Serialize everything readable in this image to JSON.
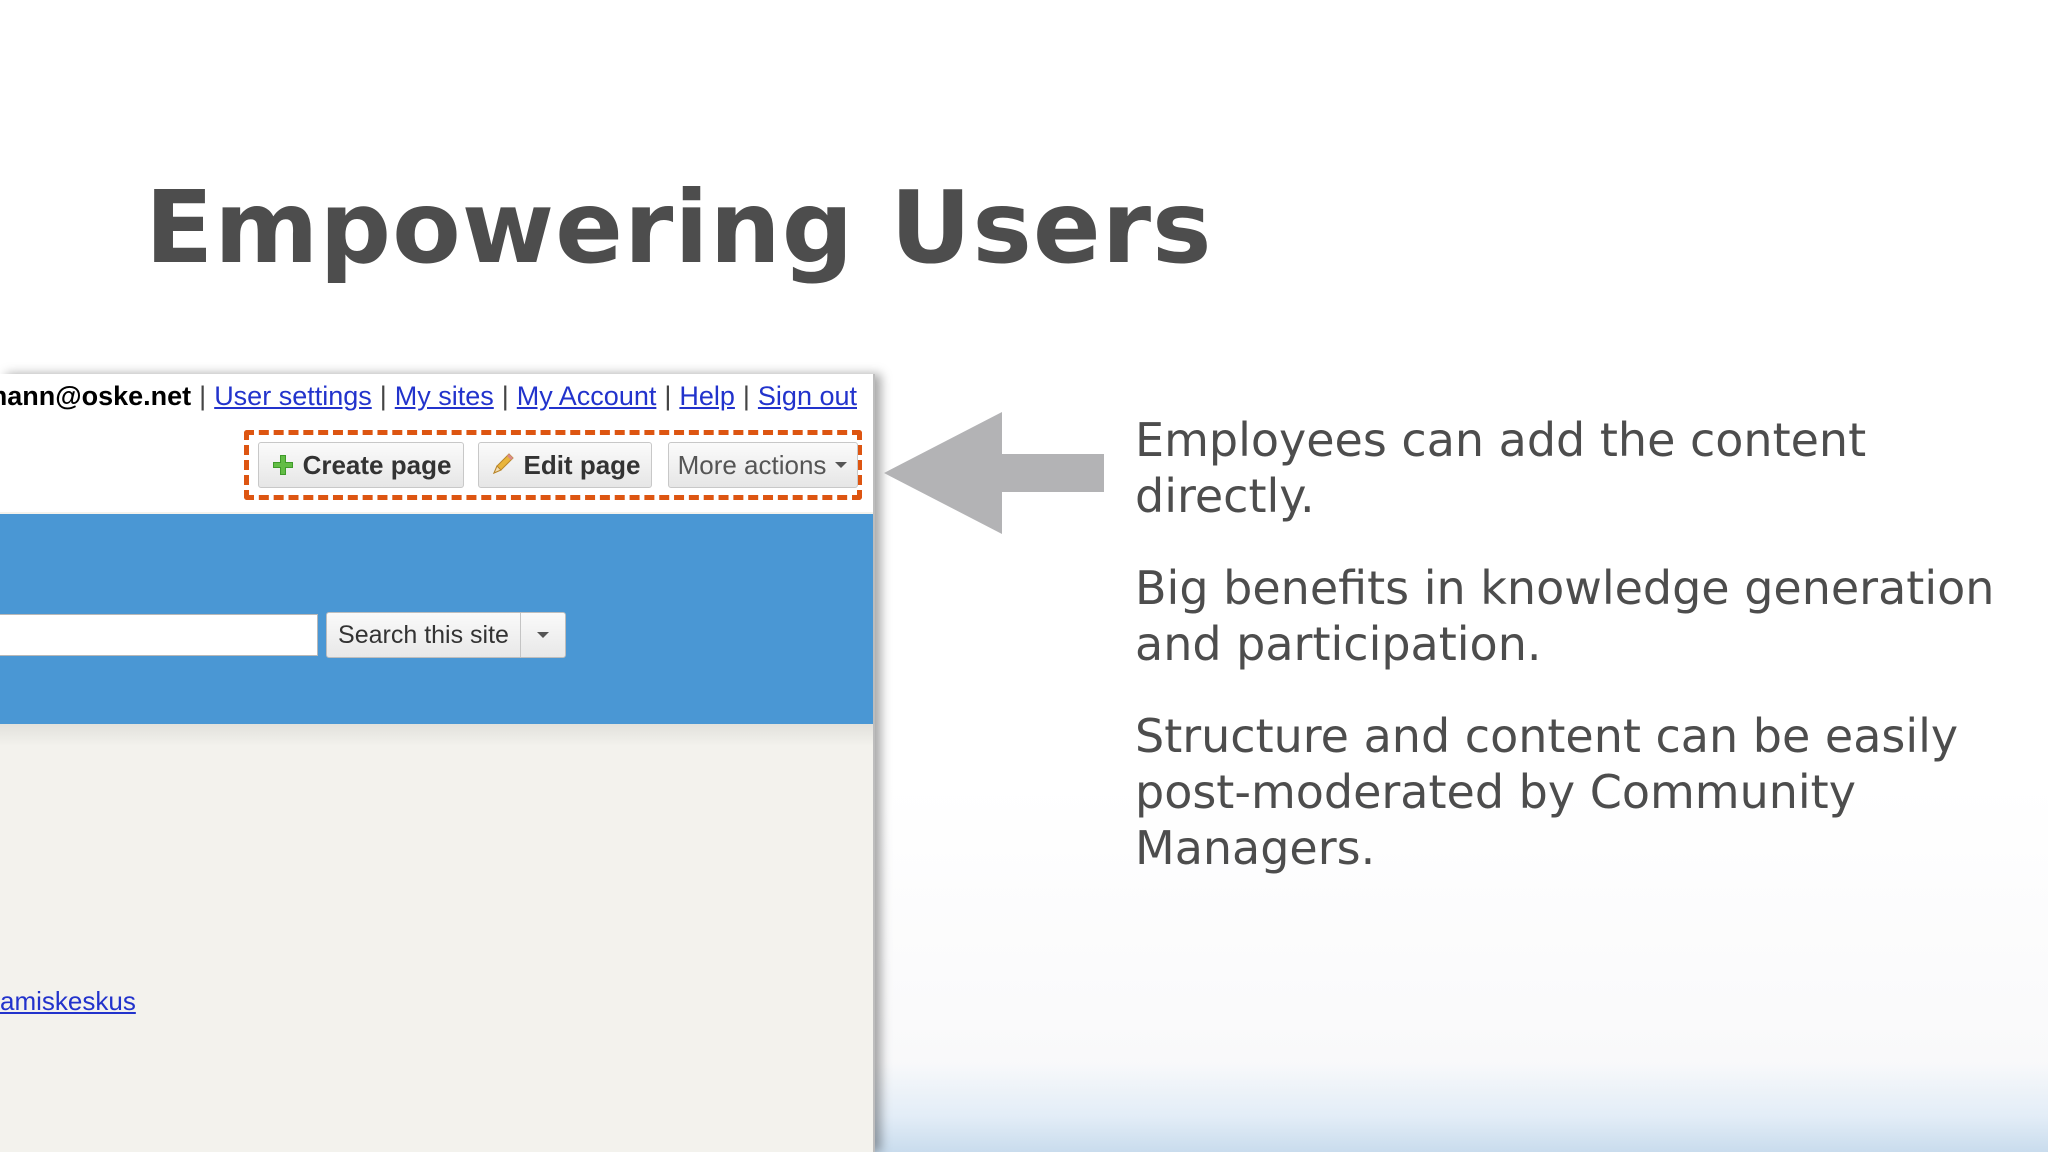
{
  "slide": {
    "title": "Empowering Users",
    "bullets": [
      "Employees can add the content directly.",
      "Big benefits in knowledge generation and participation.",
      "Structure and content can be easily post-moderated by Community Managers."
    ]
  },
  "screenshot": {
    "user_email": "mann@oske.net",
    "separator": "|",
    "links": {
      "user_settings": "User settings",
      "my_sites": "My sites",
      "my_account": "My Account",
      "help": "Help",
      "sign_out": "Sign out"
    },
    "actions": {
      "create_page": "Create page",
      "edit_page": "Edit page",
      "more_actions": "More actions"
    },
    "search": {
      "value": "",
      "button_label": "Search this site"
    },
    "site_link": "amiskeskus"
  },
  "colors": {
    "title": "#4d4d4d",
    "body_text": "#4d4d4d",
    "site_header_blue": "#4a97d4",
    "highlight_border": "#dd5511",
    "arrow": "#b3b3b5",
    "link": "#2233cc"
  },
  "icons": {
    "create": "plus-icon",
    "edit": "pencil-icon",
    "more": "caret-down-icon",
    "pointer": "arrow-left-icon"
  }
}
